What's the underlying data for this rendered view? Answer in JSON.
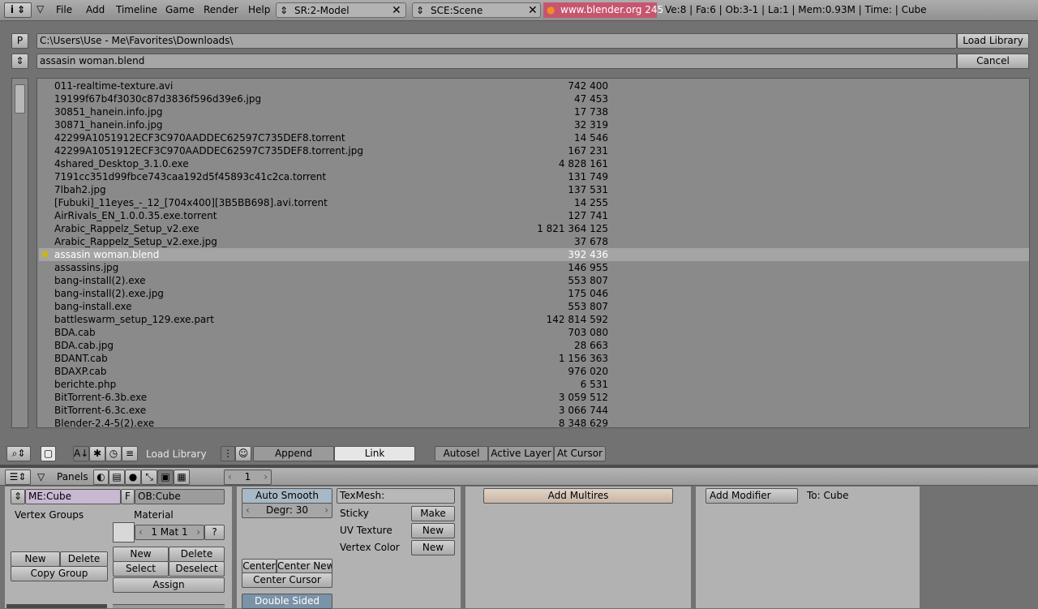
{
  "topbar": {
    "menus": [
      "File",
      "Add",
      "Timeline",
      "Game",
      "Render",
      "Help"
    ],
    "screen": "SR:2-Model",
    "scene": "SCE:Scene",
    "site": "www.blender.org 245",
    "stats": "Ve:8 | Fa:6 | Ob:3-1 | La:1  | Mem:0.93M  | Time: | Cube"
  },
  "browser": {
    "parent_btn": "P",
    "path": "C:\\Users\\Use - Me\\Favorites\\Downloads\\",
    "filename": "assasin woman.blend",
    "load_label": "Load Library",
    "cancel_label": "Cancel",
    "files": [
      {
        "name": "011-realtime-texture.avi",
        "size": "742 400"
      },
      {
        "name": "19199f67b4f3030c87d3836f596d39e6.jpg",
        "size": "47 453"
      },
      {
        "name": "30851_hanein.info.jpg",
        "size": "17 738"
      },
      {
        "name": "30871_hanein.info.jpg",
        "size": "32 319"
      },
      {
        "name": "42299A1051912ECF3C970AADDEC62597C735DEF8.torrent",
        "size": "14 546"
      },
      {
        "name": "42299A1051912ECF3C970AADDEC62597C735DEF8.torrent.jpg",
        "size": "167 231"
      },
      {
        "name": "4shared_Desktop_3.1.0.exe",
        "size": "4 828 161"
      },
      {
        "name": "7191cc351d99fbce743caa192d5f45893c41c2ca.torrent",
        "size": "131 749"
      },
      {
        "name": "7lbah2.jpg",
        "size": "137 531"
      },
      {
        "name": "[Fubuki]_11eyes_-_12_[704x400][3B5BB698].avi.torrent",
        "size": "14 255"
      },
      {
        "name": "AirRivals_EN_1.0.0.35.exe.torrent",
        "size": "127 741"
      },
      {
        "name": "Arabic_Rappelz_Setup_v2.exe",
        "size": "1 821 364 125"
      },
      {
        "name": "Arabic_Rappelz_Setup_v2.exe.jpg",
        "size": "37 678"
      },
      {
        "name": "assasin woman.blend",
        "size": "392 436"
      },
      {
        "name": "assassins.jpg",
        "size": "146 955"
      },
      {
        "name": "bang-install(2).exe",
        "size": "553 807"
      },
      {
        "name": "bang-install(2).exe.jpg",
        "size": "175 046"
      },
      {
        "name": "bang-install.exe",
        "size": "553 807"
      },
      {
        "name": "battleswarm_setup_129.exe.part",
        "size": "142 814 592"
      },
      {
        "name": "BDA.cab",
        "size": "703 080"
      },
      {
        "name": "BDA.cab.jpg",
        "size": "28 663"
      },
      {
        "name": "BDANT.cab",
        "size": "1 156 363"
      },
      {
        "name": "BDAXP.cab",
        "size": "976 020"
      },
      {
        "name": "berichte.php",
        "size": "6 531"
      },
      {
        "name": "BitTorrent-6.3b.exe",
        "size": "3 059 512"
      },
      {
        "name": "BitTorrent-6.3c.exe",
        "size": "3 066 744"
      },
      {
        "name": "Blender-2.4-5(2).exe",
        "size": "8 348 629"
      }
    ],
    "selected_index": 13
  },
  "bottombar": {
    "title": "Load Library",
    "append": "Append",
    "link": "Link",
    "autosel": "Autosel",
    "active_layer": "Active Layer",
    "at_cursor": "At Cursor"
  },
  "buttons_header": {
    "panels": "Panels",
    "frame": "1"
  },
  "mesh_panel": {
    "me": "ME:Cube",
    "f": "F",
    "ob": "OB:Cube",
    "vertex_groups": "Vertex Groups",
    "material": "Material",
    "mat": "1 Mat 1",
    "q": "?",
    "new": "New",
    "delete": "Delete",
    "copy_group": "Copy Group",
    "mat_new": "New",
    "mat_delete": "Delete",
    "select": "Select",
    "deselect": "Deselect",
    "assign": "Assign"
  },
  "link_panel": {
    "auto_smooth": "Auto Smooth",
    "degr": "Degr: 30",
    "center": "Center",
    "center_new": "Center New",
    "center_cursor": "Center Cursor",
    "double_sided": "Double Sided"
  },
  "tex_panel": {
    "texmesh": "TexMesh:",
    "sticky": "Sticky",
    "make": "Make",
    "uv": "UV Texture",
    "uv_new": "New",
    "vcol": "Vertex Color",
    "vcol_new": "New"
  },
  "multires": {
    "label": "Add Multires"
  },
  "modifiers": {
    "add": "Add Modifier",
    "to": "To: Cube"
  }
}
